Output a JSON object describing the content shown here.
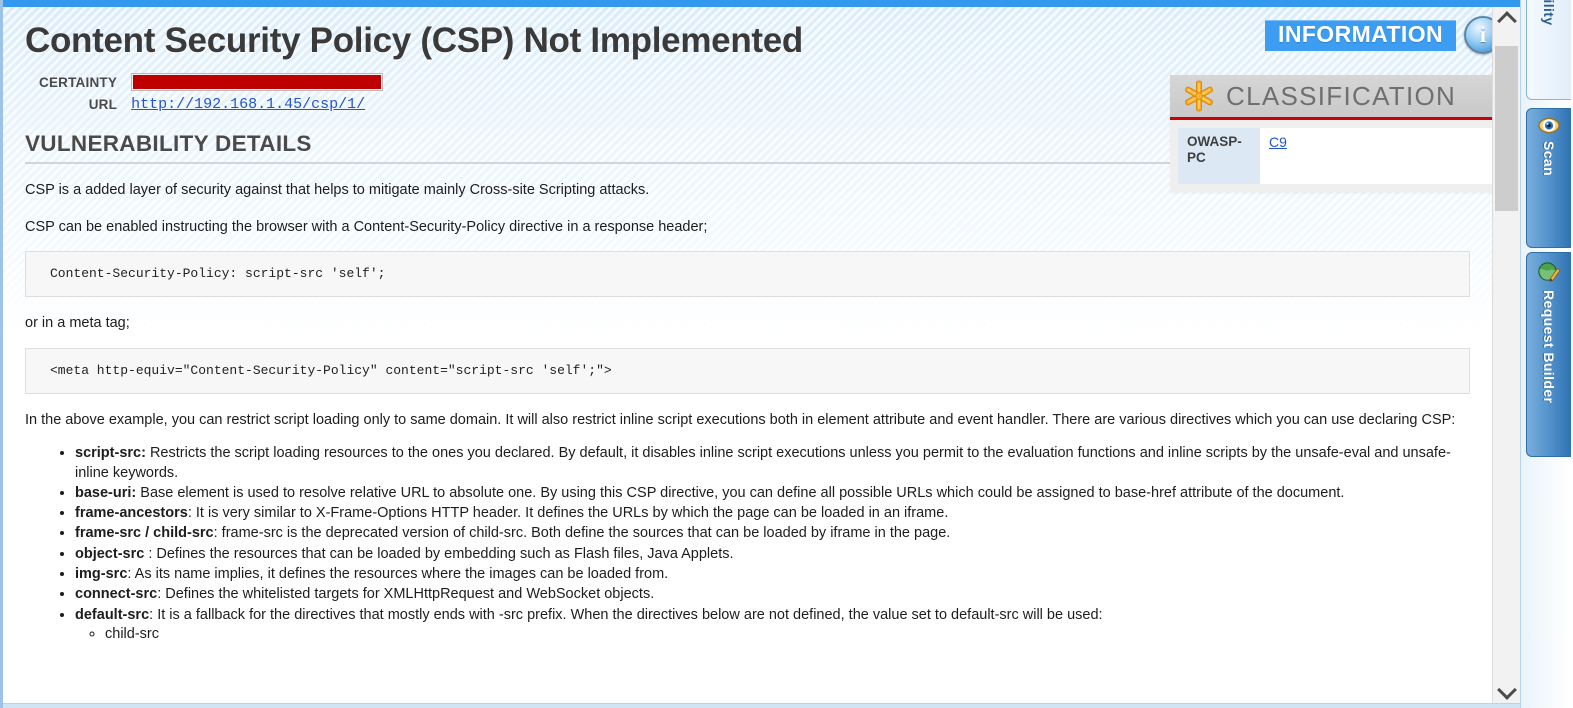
{
  "window": {
    "accent_blue": "#3399ee",
    "severity_color": "#3d9df3",
    "certainty_color": "#bf0000"
  },
  "report": {
    "title": "Content Security Policy (CSP) Not Implemented",
    "severity_badge": "INFORMATION",
    "severity_icon": "info-icon",
    "meta": {
      "certainty_label": "CERTAINTY",
      "certainty_percent": 100,
      "url_label": "URL",
      "url_value": "http://192.168.1.45/csp/1/"
    },
    "section_heading": "VULNERABILITY DETAILS",
    "paragraphs": {
      "intro_1": "CSP is a added layer of security against that helps to mitigate mainly Cross-site Scripting attacks.",
      "intro_2": "CSP can be enabled instructing the browser with a Content-Security-Policy directive in a response header;",
      "meta_tag_lead": "or in a meta tag;",
      "example_explanation": "In the above example, you can restrict script loading only to same domain. It will also restrict inline script executions both in element attribute and event handler. There are various directives which you can use declaring CSP:"
    },
    "code_blocks": {
      "header_example": "Content-Security-Policy: script-src 'self';",
      "meta_example": "<meta http-equiv=\"Content-Security-Policy\" content=\"script-src 'self';\">"
    },
    "directives": [
      {
        "name": "script-src:",
        "text": " Restricts the script loading resources to the ones you declared. By default, it disables inline script executions unless you permit to the evaluation functions and inline scripts by the unsafe-eval and unsafe-inline keywords."
      },
      {
        "name": "base-uri:",
        "text": "  Base element is used to resolve relative URL to absolute one. By using this CSP directive, you can define all possible URLs which could be assigned to base-href attribute of the document."
      },
      {
        "name": "frame-ancestors",
        "text": ":  It is very similar to X-Frame-Options HTTP header. It defines the URLs by which the page can be loaded in an iframe."
      },
      {
        "name": "frame-src   / child-src",
        "text": ": frame-src is the deprecated version of child-src. Both define the sources that can be loaded by iframe in the page."
      },
      {
        "name": "object-src",
        "text": " : Defines the resources that can be loaded by embedding such as Flash files, Java Applets."
      },
      {
        "name": "img-src",
        "text": ": As its name implies, it defines the resources where the images can be loaded from."
      },
      {
        "name": "connect-src",
        "text": ": Defines the whitelisted targets for XMLHttpRequest and WebSocket objects."
      },
      {
        "name": "default-src",
        "text": ": It is a fallback for the directives that mostly ends with -src prefix. When the directives below are not defined, the value set to default-src will be used:",
        "sub_items": [
          "child-src"
        ]
      }
    ],
    "classification": {
      "icon": "starburst-icon",
      "title": "CLASSIFICATION",
      "rows": [
        {
          "key": "OWASP-PC",
          "value": "C9"
        }
      ]
    }
  },
  "scrollbar": {
    "up_icon": "chevron-up-icon",
    "down_icon": "chevron-down-icon",
    "thumb_position_percent": 3
  },
  "tab_rail": {
    "tabs": [
      {
        "label": "lnerability",
        "icon": "bug-icon",
        "state": "inactive"
      },
      {
        "label": "Scan",
        "icon": "eye-icon",
        "state": "active"
      },
      {
        "label": "Request Builder",
        "icon": "globe-pencil-icon",
        "state": "active"
      }
    ]
  }
}
